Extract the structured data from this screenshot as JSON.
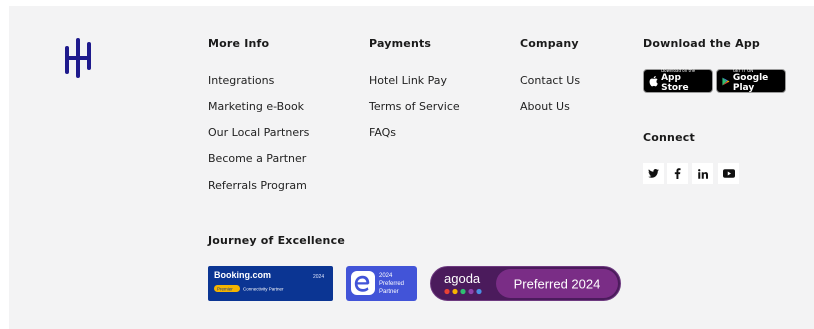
{
  "columns": {
    "more_info": {
      "title": "More Info",
      "links": [
        "Integrations",
        "Marketing e-Book",
        "Our Local Partners",
        "Become a Partner",
        "Referrals Program"
      ]
    },
    "payments": {
      "title": "Payments",
      "links": [
        "Hotel Link Pay",
        "Terms of Service",
        "FAQs"
      ]
    },
    "company": {
      "title": "Company",
      "links": [
        "Contact Us",
        "About Us"
      ]
    }
  },
  "download": {
    "title": "Download the App",
    "app_store": {
      "small": "Download on the",
      "big": "App Store"
    },
    "google_play": {
      "small": "GET IT ON",
      "big": "Google Play"
    }
  },
  "connect": {
    "title": "Connect",
    "icons": [
      "twitter-icon",
      "facebook-icon",
      "linkedin-icon",
      "youtube-icon"
    ]
  },
  "journey": {
    "title": "Journey of Excellence",
    "booking": {
      "brand": "Booking.com",
      "year": "2024",
      "tag": "Premier",
      "label": "Connectivity Partner"
    },
    "expedia": {
      "year": "2024",
      "line1": "Preferred",
      "line2": "Partner"
    },
    "agoda": {
      "brand": "agoda",
      "label": "Preferred 2024"
    }
  },
  "colors": {
    "logo": "#1e1a8c",
    "booking_bg": "#0b3593",
    "expedia_bg": "#4254d8",
    "agoda_bg": "#4b1b5c",
    "agoda_pill": "#7a2d86"
  }
}
